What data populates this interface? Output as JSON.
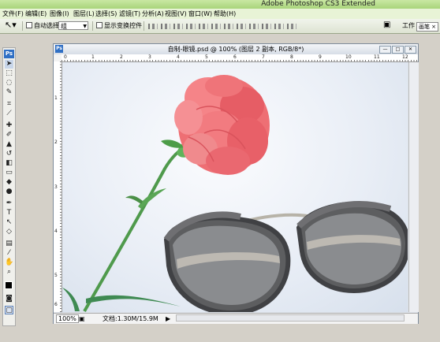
{
  "app": {
    "title": "Adobe Photoshop CS3 Extended"
  },
  "menu": [
    "文件(F)",
    "编辑(E)",
    "图像(I)",
    "图层(L)",
    "选择(S)",
    "滤镜(T)",
    "分析(A)",
    "视图(V)",
    "窗口(W)",
    "帮助(H)"
  ],
  "options": {
    "auto_select_label": "自动选择:",
    "auto_select_value": "组",
    "show_transform_label": "显示变换控件",
    "workspace_label": "工作",
    "workspace_tab": "画笔"
  },
  "document": {
    "title": "自制-眼镜.psd @ 100% (图层 2 副本, RGB/8*)",
    "zoom": "100%",
    "doc_size": "文档:1.30M/15.9M"
  },
  "rulers": {
    "top": [
      "0",
      "1",
      "2",
      "3",
      "4",
      "5",
      "6",
      "7",
      "8",
      "9",
      "10",
      "11",
      "12"
    ],
    "left": [
      "1",
      "2",
      "3",
      "4",
      "5",
      "6"
    ]
  },
  "icons": {
    "tools": [
      "move-icon",
      "marquee-icon",
      "lasso-icon",
      "quick-select-icon",
      "crop-icon",
      "slice-icon",
      "healing-icon",
      "brush-icon",
      "stamp-icon",
      "history-brush-icon",
      "eraser-icon",
      "gradient-icon",
      "blur-icon",
      "dodge-icon",
      "pen-icon",
      "type-icon",
      "path-select-icon",
      "shape-icon",
      "notes-icon",
      "eyedropper-icon",
      "hand-icon",
      "zoom-icon"
    ]
  },
  "colors": {
    "title_bar": "#b8de8c",
    "menu_bar": "#e8f3d6",
    "canvas": "#e6ecf4",
    "flower": "#ee6f74",
    "stem": "#4f9a4c"
  }
}
